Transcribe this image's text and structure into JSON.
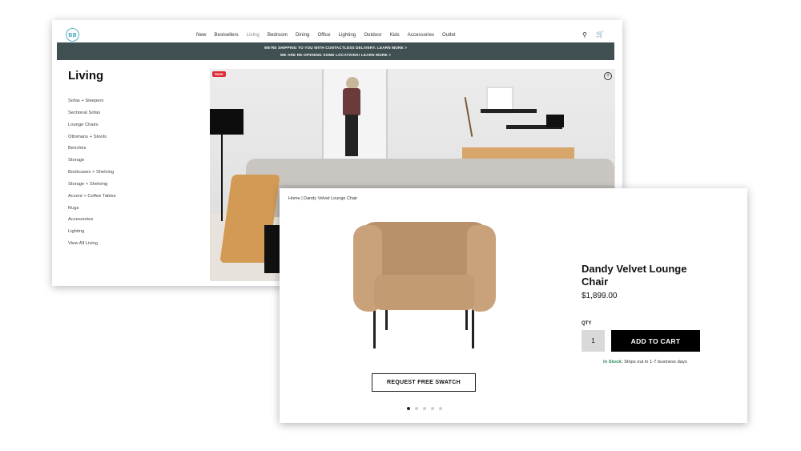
{
  "listing": {
    "nav": [
      "New",
      "Bestsellers",
      "Living",
      "Bedroom",
      "Dining",
      "Office",
      "Lighting",
      "Outdoor",
      "Kids",
      "Accessories",
      "Outlet"
    ],
    "active_nav": "Living",
    "banner_line1": "WE'RE SHIPPING TO YOU WITH CONTACTLESS DELIVERY. LEARN MORE >",
    "banner_line2": "WE ARE RE-OPENING SOME LOCATIONS! LEARN MORE >",
    "category_title": "Living",
    "categories": [
      "Sofas + Sleepers",
      "Sectional Sofas",
      "Lounge Chairs",
      "Ottomans + Stools",
      "Benches",
      "Storage",
      "Bookcases + Shelving",
      "Storage + Shelving",
      "Accent + Coffee Tables",
      "Rugs",
      "Accessories",
      "Lighting",
      "View All Living"
    ],
    "save_badge": "Save"
  },
  "product": {
    "breadcrumb": "Home | Dandy Velvet Lounge Chair",
    "title": "Dandy Velvet Lounge Chair",
    "price": "$1,899.00",
    "qty_label": "QTY",
    "qty_value": "1",
    "add_to_cart": "ADD TO CART",
    "stock_status": "In Stock:",
    "stock_note": "Ships out in 1-7 business days",
    "swatch_button": "REQUEST FREE SWATCH",
    "carousel_total": 5,
    "carousel_active": 1
  },
  "colors": {
    "banner_bg": "#3f4f52",
    "in_stock": "#2e8b57",
    "save_badge": "#e02a37",
    "primary_button": "#000000"
  },
  "icons": [
    "logo-icon",
    "search-icon",
    "cart-icon",
    "zoom-icon"
  ]
}
